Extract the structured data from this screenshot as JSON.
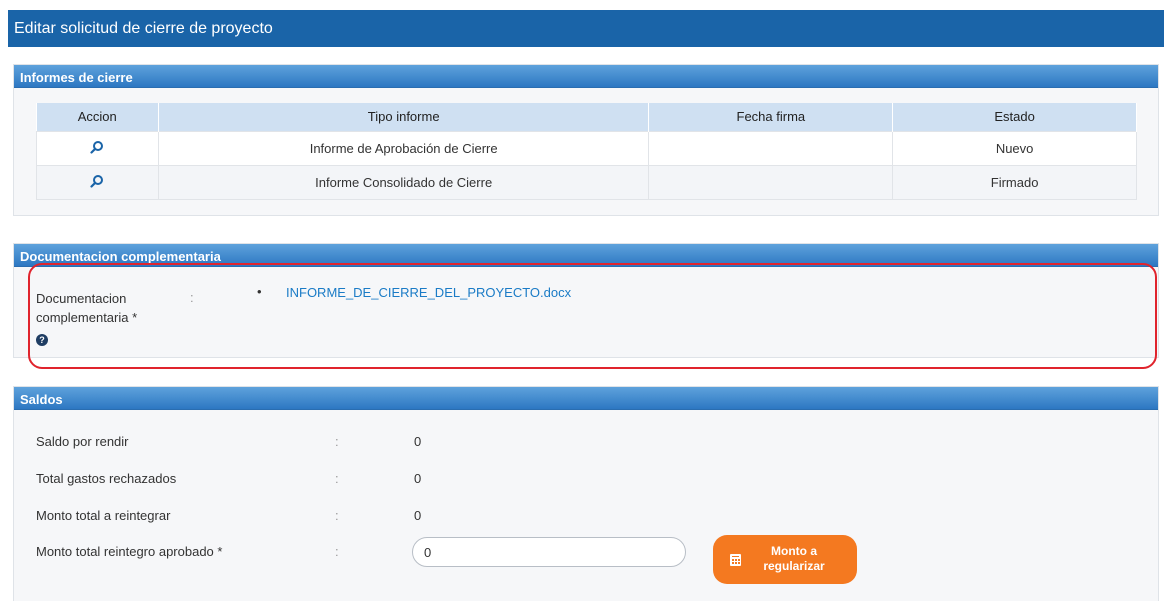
{
  "window": {
    "title": "Editar solicitud de cierre de proyecto"
  },
  "informes": {
    "header": "Informes de cierre",
    "columns": [
      "Accion",
      "Tipo informe",
      "Fecha firma",
      "Estado"
    ],
    "rows": [
      {
        "tipo": "Informe de Aprobación de Cierre",
        "fecha": "",
        "estado": "Nuevo"
      },
      {
        "tipo": "Informe Consolidado de Cierre",
        "fecha": "",
        "estado": "Firmado"
      }
    ],
    "action_icon": "magnifier-icon"
  },
  "documentacion": {
    "header": "Documentacion complementaria",
    "label": "Documentacion complementaria *",
    "colon": ":",
    "bullet": "•",
    "file": "INFORME_DE_CIERRE_DEL_PROYECTO.docx",
    "help_icon": "question-circle-icon",
    "help_glyph": "?"
  },
  "saldos": {
    "header": "Saldos",
    "colon": ":",
    "rows": [
      {
        "label": "Saldo por rendir",
        "value": "0"
      },
      {
        "label": "Total gastos rechazados",
        "value": "0"
      },
      {
        "label": "Monto total a reintegrar",
        "value": "0"
      }
    ],
    "input_label": "Monto total reintegro aprobado *",
    "input_value": "0",
    "button_line1": "Monto a",
    "button_line2": "regularizar",
    "button_icon": "calculator-icon"
  },
  "colors": {
    "title_bar": "#1a64a8",
    "panel_header": "#2d77c2",
    "table_header": "#cfe0f2",
    "link": "#1a7bc6",
    "button": "#f47920",
    "highlight": "#e0242d"
  }
}
